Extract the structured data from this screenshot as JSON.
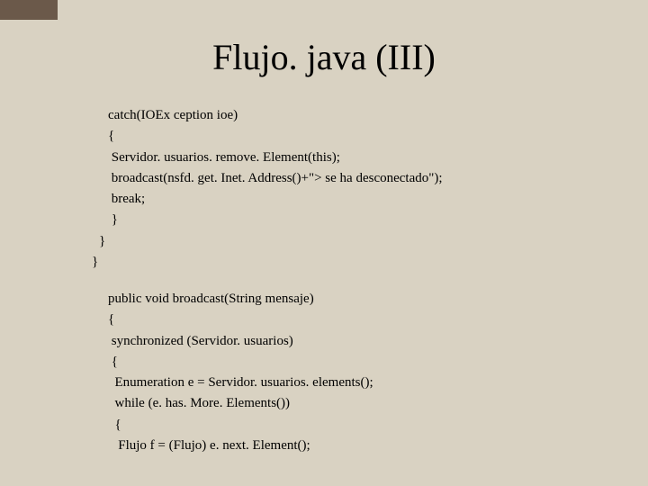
{
  "title": "Flujo. java (III)",
  "code1": {
    "l0": "catch(IOEx ception ioe)",
    "l1": "{",
    "l2": " Servidor. usuarios. remove. Element(this);",
    "l3": " broadcast(nsfd. get. Inet. Address()+\"> se ha desconectado\");",
    "l4": " break;",
    "l5": " }",
    "l6": "}",
    "l7": "}"
  },
  "code2": {
    "l0": "public void broadcast(String mensaje)",
    "l1": "{",
    "l2": " synchronized (Servidor. usuarios)",
    "l3": " {",
    "l4": "  Enumeration e = Servidor. usuarios. elements();",
    "l5": "  while (e. has. More. Elements())",
    "l6": "  {",
    "l7": "   Flujo f = (Flujo) e. next. Element();"
  }
}
